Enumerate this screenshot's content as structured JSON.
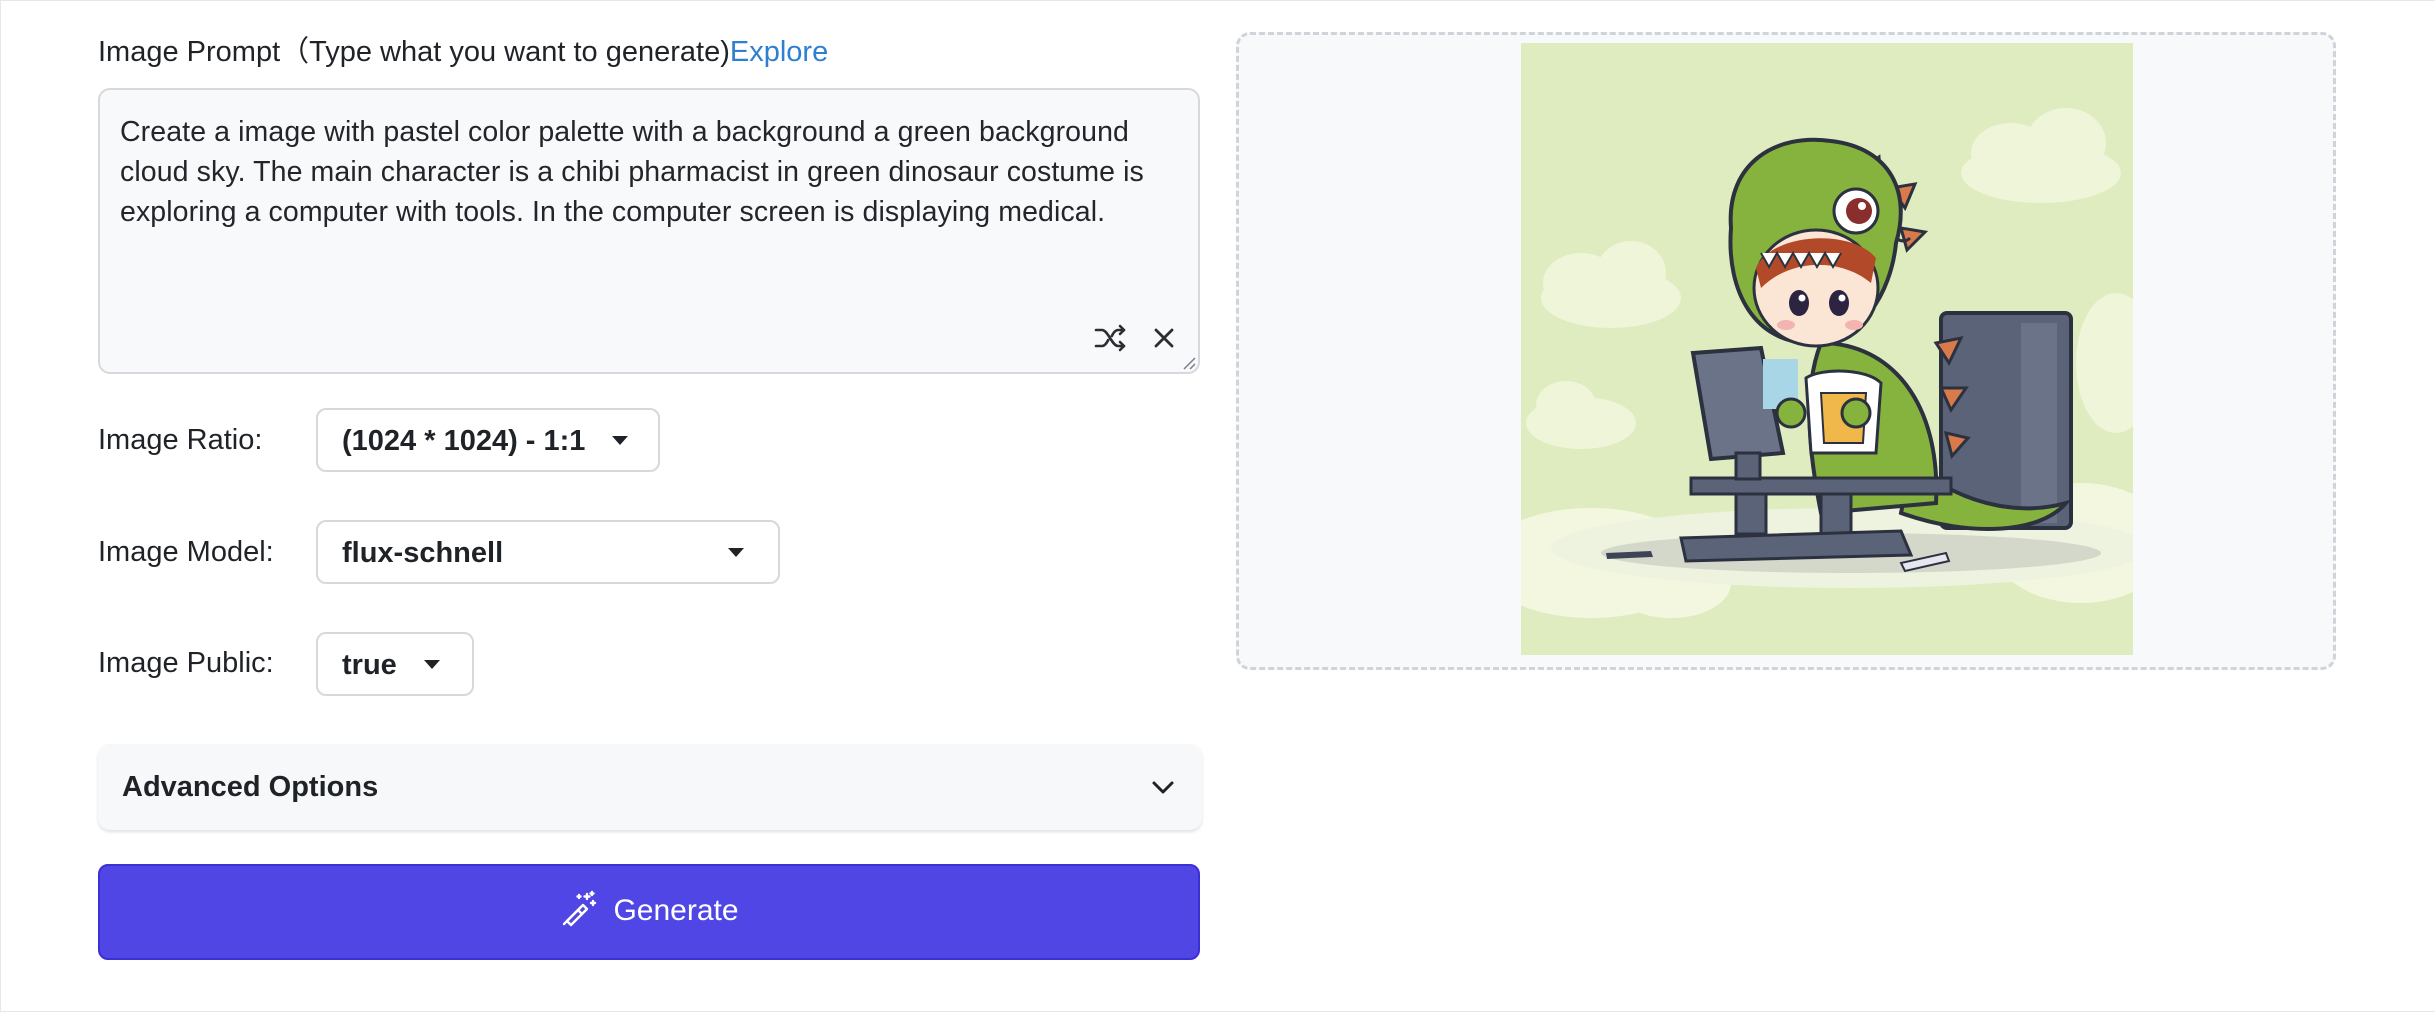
{
  "prompt": {
    "label": "Image Prompt（Type what you want to generate)",
    "explore_link": "Explore",
    "value": "Create a image with pastel color palette with a background a green background cloud sky. The main character is a chibi pharmacist in green dinosaur costume is exploring a computer with tools. In the computer screen is displaying medical.",
    "icons": [
      "shuffle-icon",
      "close-icon"
    ]
  },
  "ratio": {
    "label": "Image Ratio:",
    "value": "(1024 * 1024) - 1:1"
  },
  "model": {
    "label": "Image Model:",
    "value": "flux-schnell"
  },
  "public": {
    "label": "Image Public:",
    "value": "true"
  },
  "advanced": {
    "label": "Advanced Options"
  },
  "generate": {
    "label": "Generate"
  },
  "preview": {
    "image_description": "chibi pharmacist in green dinosaur costume at a computer"
  },
  "colors": {
    "accent": "#4f46e5",
    "link": "#2f7fd1"
  }
}
